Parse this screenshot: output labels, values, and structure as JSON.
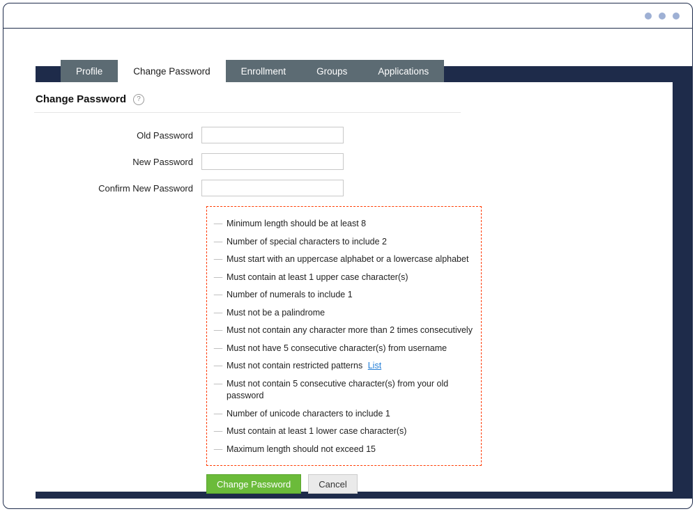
{
  "tabs": [
    {
      "label": "Profile",
      "active": false
    },
    {
      "label": "Change Password",
      "active": true
    },
    {
      "label": "Enrollment",
      "active": false
    },
    {
      "label": "Groups",
      "active": false
    },
    {
      "label": "Applications",
      "active": false
    }
  ],
  "page": {
    "title": "Change Password",
    "help_glyph": "?"
  },
  "form": {
    "old_password": {
      "label": "Old Password",
      "value": ""
    },
    "new_password": {
      "label": "New Password",
      "value": ""
    },
    "confirm_password": {
      "label": "Confirm New Password",
      "value": ""
    }
  },
  "rules": [
    {
      "text": "Minimum length should be at least 8"
    },
    {
      "text": "Number of special characters to include 2"
    },
    {
      "text": "Must start with an uppercase alphabet or a lowercase alphabet"
    },
    {
      "text": "Must contain at least 1 upper case character(s)"
    },
    {
      "text": "Number of numerals to include 1"
    },
    {
      "text": "Must not be a palindrome"
    },
    {
      "text": "Must not contain any character more than 2 times consecutively"
    },
    {
      "text": "Must not have 5 consecutive character(s) from username"
    },
    {
      "text": "Must not contain restricted patterns",
      "link": "List"
    },
    {
      "text": "Must not contain 5 consecutive character(s) from your old password"
    },
    {
      "text": "Number of unicode characters to include 1"
    },
    {
      "text": "Must contain at least 1 lower case character(s)"
    },
    {
      "text": "Maximum length should not exceed 15"
    }
  ],
  "buttons": {
    "submit": "Change Password",
    "cancel": "Cancel"
  },
  "dash": "—"
}
